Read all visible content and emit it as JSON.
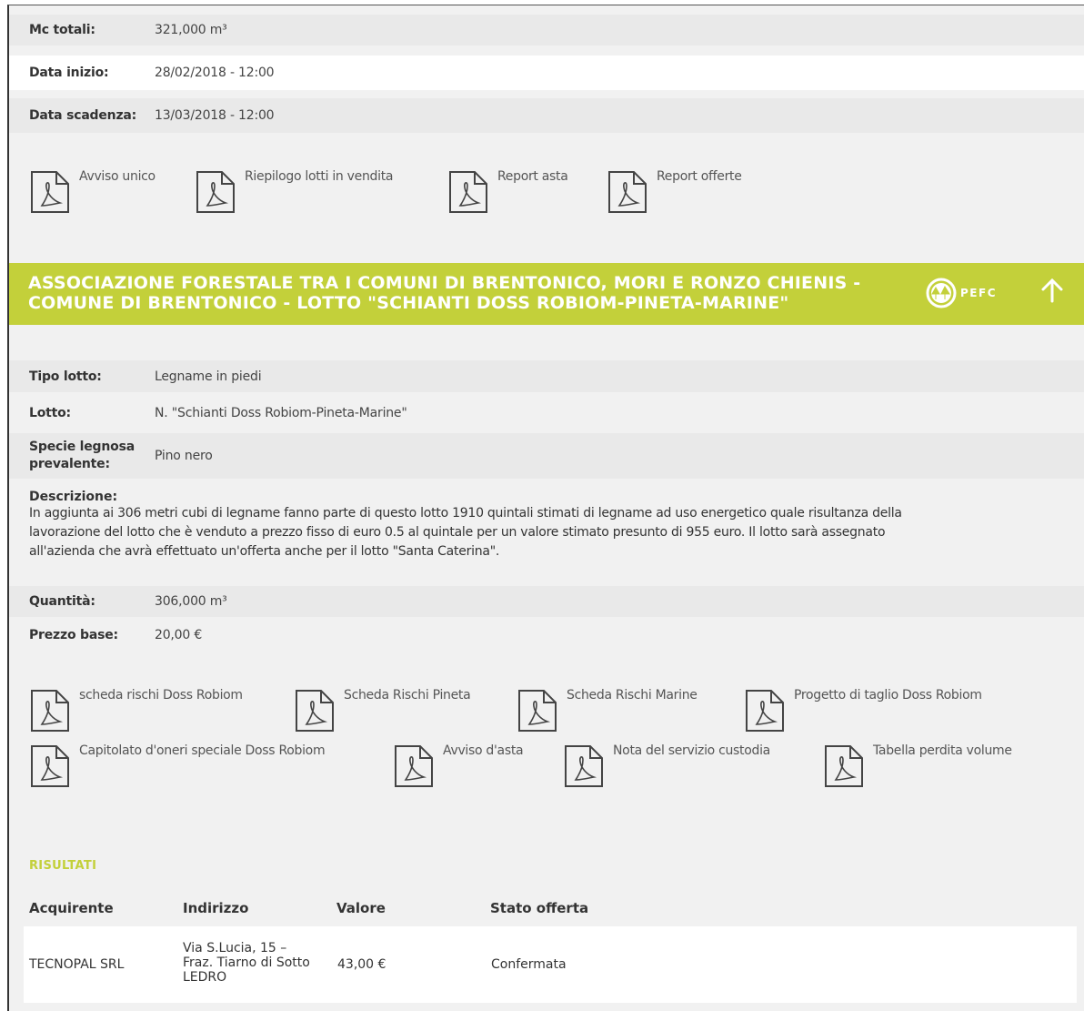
{
  "summary": {
    "mc_totali_label": "Mc totali:",
    "mc_totali_value": "321,000 m³",
    "data_inizio_label": "Data inizio:",
    "data_inizio_value": "28/02/2018 - 12:00",
    "data_scadenza_label": "Data scadenza:",
    "data_scadenza_value": "13/03/2018 - 12:00"
  },
  "top_docs": [
    {
      "label": "Avviso unico",
      "icon": "pdf-icon"
    },
    {
      "label": "Riepilogo lotti in vendita",
      "icon": "pdf-icon"
    },
    {
      "label": "Report asta",
      "icon": "pdf-icon"
    },
    {
      "label": "Report offerte",
      "icon": "pdf-icon"
    }
  ],
  "banner": {
    "line1": "ASSOCIAZIONE FORESTALE TRA I COMUNI DI BRENTONICO, MORI E RONZO CHIENIS -",
    "line2": "COMUNE DI BRENTONICO - LOTTO \"SCHIANTI DOSS ROBIOM-PINETA-MARINE\"",
    "logo_text": "PEFC",
    "accent_color": "#c3d03a"
  },
  "lotto": {
    "tipo_label": "Tipo lotto:",
    "tipo_value": "Legname in piedi",
    "lotto_label": "Lotto:",
    "lotto_value": "N. \"Schianti Doss Robiom-Pineta-Marine\"",
    "specie_label_1": "Specie legnosa",
    "specie_label_2": "prevalente:",
    "specie_value": "Pino nero",
    "descrizione_label": "Descrizione:",
    "descrizione_line1": "In aggiunta ai 306 metri cubi di legname fanno parte di questo lotto 1910 quintali stimati di legname ad uso energetico quale risultanza della",
    "descrizione_line2": "lavorazione del lotto che è venduto a prezzo fisso di euro 0.5 al quintale per un valore stimato presunto di 955 euro. Il lotto sarà assegnato",
    "descrizione_line3": "all'azienda che avrà effettuato un'offerta anche per il lotto \"Santa Caterina\".",
    "quantita_label": "Quantità:",
    "quantita_value": "306,000 m³",
    "prezzo_label": "Prezzo base:",
    "prezzo_value": "20,00 €"
  },
  "lot_docs": [
    {
      "label": "scheda rischi Doss Robiom",
      "icon": "pdf-icon"
    },
    {
      "label": "Scheda Rischi Pineta",
      "icon": "pdf-icon"
    },
    {
      "label": "Scheda Rischi Marine",
      "icon": "pdf-icon"
    },
    {
      "label": "Progetto di taglio Doss Robiom",
      "icon": "pdf-icon"
    },
    {
      "label": "Capitolato d'oneri speciale Doss Robiom",
      "icon": "pdf-icon"
    },
    {
      "label": "Avviso d'asta",
      "icon": "pdf-icon"
    },
    {
      "label": "Nota del servizio custodia",
      "icon": "pdf-icon"
    },
    {
      "label": "Tabella perdita volume",
      "icon": "pdf-icon"
    }
  ],
  "results": {
    "title": "RISULTATI",
    "headers": [
      "Acquirente",
      "Indirizzo",
      "Valore",
      "Stato offerta"
    ],
    "rows": [
      {
        "acquirente": "TECNOPAL SRL",
        "indirizzo_1": "Via S.Lucia, 15 –",
        "indirizzo_2": "Fraz. Tiarno di Sotto",
        "indirizzo_3": "LEDRO",
        "valore": "43,00 €",
        "stato": "Confermata"
      }
    ]
  }
}
